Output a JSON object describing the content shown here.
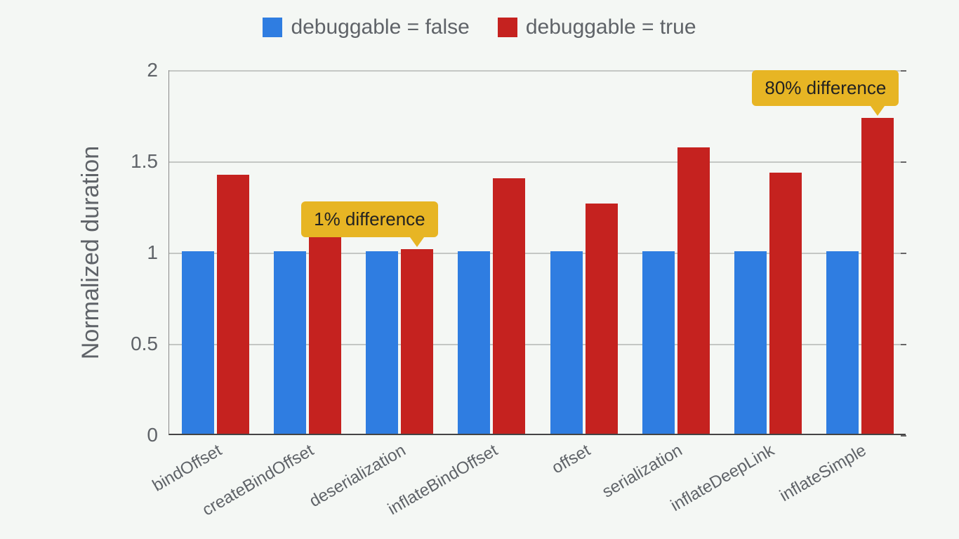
{
  "chart_data": {
    "type": "bar",
    "ylabel": "Normalized duration",
    "ylim": [
      0,
      2
    ],
    "yticks": [
      0,
      0.5,
      1,
      1.5,
      2
    ],
    "categories": [
      "bindOffset",
      "createBindOffset",
      "deserialization",
      "inflateBindOffset",
      "offset",
      "serialization",
      "inflateDeepLink",
      "inflateSimple"
    ],
    "series": [
      {
        "name": "debuggable = false",
        "color": "#2f7de1",
        "values": [
          1.0,
          1.0,
          1.0,
          1.0,
          1.0,
          1.0,
          1.0,
          1.0
        ]
      },
      {
        "name": "debuggable = true",
        "color": "#c5221f",
        "values": [
          1.42,
          1.19,
          1.01,
          1.4,
          1.26,
          1.57,
          1.43,
          1.73
        ]
      }
    ],
    "annotations": [
      {
        "text": "1% difference",
        "category_index": 2
      },
      {
        "text": "80% difference",
        "category_index": 7
      }
    ]
  }
}
